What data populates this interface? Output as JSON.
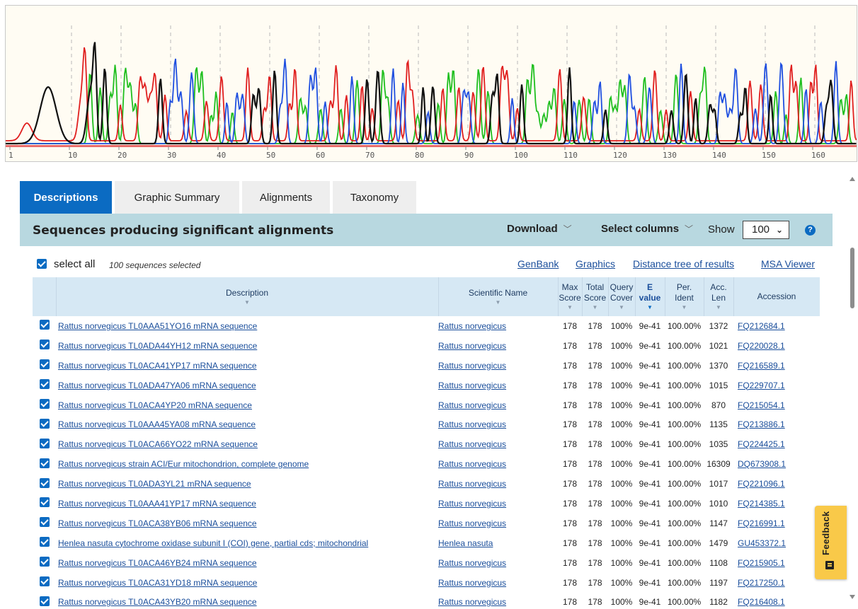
{
  "chromatogram": {
    "axis_ticks": [
      "1",
      "10",
      "20",
      "30",
      "40",
      "50",
      "60",
      "70",
      "80",
      "90",
      "100",
      "110",
      "120",
      "130",
      "140",
      "150",
      "160"
    ]
  },
  "tabs": [
    {
      "label": "Descriptions",
      "active": true
    },
    {
      "label": "Graphic Summary",
      "active": false
    },
    {
      "label": "Alignments",
      "active": false
    },
    {
      "label": "Taxonomy",
      "active": false
    }
  ],
  "header": {
    "title": "Sequences producing significant alignments",
    "download_label": "Download",
    "select_columns_label": "Select columns",
    "show_label": "Show",
    "show_value": "100",
    "help_glyph": "?"
  },
  "select_all": {
    "label": "select all",
    "count_text": "100 sequences selected",
    "links": [
      "GenBank",
      "Graphics",
      "Distance tree of results",
      "MSA Viewer"
    ]
  },
  "table": {
    "columns": [
      {
        "label": "",
        "sub": ""
      },
      {
        "label": "Description",
        "sub": ""
      },
      {
        "label": "Scientific Name",
        "sub": ""
      },
      {
        "label": "Max",
        "sub": "Score"
      },
      {
        "label": "Total",
        "sub": "Score"
      },
      {
        "label": "Query",
        "sub": "Cover"
      },
      {
        "label": "E",
        "sub": "value"
      },
      {
        "label": "Per.",
        "sub": "Ident"
      },
      {
        "label": "Acc.",
        "sub": "Len"
      },
      {
        "label": "Accession",
        "sub": ""
      }
    ],
    "sorted_column": "E value",
    "rows": [
      {
        "description": "Rattus norvegicus TL0AAA51YO16 mRNA sequence",
        "scientific_name": "Rattus norvegicus",
        "max_score": "178",
        "total_score": "178",
        "query_cover": "100%",
        "e_value": "9e-41",
        "per_ident": "100.00%",
        "acc_len": "1372",
        "accession": "FQ212684.1"
      },
      {
        "description": "Rattus norvegicus TL0ADA44YH12 mRNA sequence",
        "scientific_name": "Rattus norvegicus",
        "max_score": "178",
        "total_score": "178",
        "query_cover": "100%",
        "e_value": "9e-41",
        "per_ident": "100.00%",
        "acc_len": "1021",
        "accession": "FQ220028.1"
      },
      {
        "description": "Rattus norvegicus TL0ACA41YP17 mRNA sequence",
        "scientific_name": "Rattus norvegicus",
        "max_score": "178",
        "total_score": "178",
        "query_cover": "100%",
        "e_value": "9e-41",
        "per_ident": "100.00%",
        "acc_len": "1370",
        "accession": "FQ216589.1"
      },
      {
        "description": "Rattus norvegicus TL0ADA47YA06 mRNA sequence",
        "scientific_name": "Rattus norvegicus",
        "max_score": "178",
        "total_score": "178",
        "query_cover": "100%",
        "e_value": "9e-41",
        "per_ident": "100.00%",
        "acc_len": "1015",
        "accession": "FQ229707.1"
      },
      {
        "description": "Rattus norvegicus TL0ACA4YP20 mRNA sequence",
        "scientific_name": "Rattus norvegicus",
        "max_score": "178",
        "total_score": "178",
        "query_cover": "100%",
        "e_value": "9e-41",
        "per_ident": "100.00%",
        "acc_len": "870",
        "accession": "FQ215054.1"
      },
      {
        "description": "Rattus norvegicus TL0AAA45YA08 mRNA sequence",
        "scientific_name": "Rattus norvegicus",
        "max_score": "178",
        "total_score": "178",
        "query_cover": "100%",
        "e_value": "9e-41",
        "per_ident": "100.00%",
        "acc_len": "1135",
        "accession": "FQ213886.1"
      },
      {
        "description": "Rattus norvegicus TL0ACA66YO22 mRNA sequence",
        "scientific_name": "Rattus norvegicus",
        "max_score": "178",
        "total_score": "178",
        "query_cover": "100%",
        "e_value": "9e-41",
        "per_ident": "100.00%",
        "acc_len": "1035",
        "accession": "FQ224425.1"
      },
      {
        "description": "Rattus norvegicus strain ACI/Eur mitochondrion, complete genome",
        "scientific_name": "Rattus norvegicus",
        "max_score": "178",
        "total_score": "178",
        "query_cover": "100%",
        "e_value": "9e-41",
        "per_ident": "100.00%",
        "acc_len": "16309",
        "accession": "DQ673908.1"
      },
      {
        "description": "Rattus norvegicus TL0ADA3YL21 mRNA sequence",
        "scientific_name": "Rattus norvegicus",
        "max_score": "178",
        "total_score": "178",
        "query_cover": "100%",
        "e_value": "9e-41",
        "per_ident": "100.00%",
        "acc_len": "1017",
        "accession": "FQ221096.1"
      },
      {
        "description": "Rattus norvegicus TL0AAA41YP17 mRNA sequence",
        "scientific_name": "Rattus norvegicus",
        "max_score": "178",
        "total_score": "178",
        "query_cover": "100%",
        "e_value": "9e-41",
        "per_ident": "100.00%",
        "acc_len": "1010",
        "accession": "FQ214385.1"
      },
      {
        "description": "Rattus norvegicus TL0ACA38YB06 mRNA sequence",
        "scientific_name": "Rattus norvegicus",
        "max_score": "178",
        "total_score": "178",
        "query_cover": "100%",
        "e_value": "9e-41",
        "per_ident": "100.00%",
        "acc_len": "1147",
        "accession": "FQ216991.1"
      },
      {
        "description": "Henlea nasuta cytochrome oxidase subunit I (COI) gene, partial cds; mitochondrial",
        "scientific_name": "Henlea nasuta",
        "max_score": "178",
        "total_score": "178",
        "query_cover": "100%",
        "e_value": "9e-41",
        "per_ident": "100.00%",
        "acc_len": "1479",
        "accession": "GU453372.1"
      },
      {
        "description": "Rattus norvegicus TL0ACA46YB24 mRNA sequence",
        "scientific_name": "Rattus norvegicus",
        "max_score": "178",
        "total_score": "178",
        "query_cover": "100%",
        "e_value": "9e-41",
        "per_ident": "100.00%",
        "acc_len": "1108",
        "accession": "FQ215905.1"
      },
      {
        "description": "Rattus norvegicus TL0ACA31YD18 mRNA sequence",
        "scientific_name": "Rattus norvegicus",
        "max_score": "178",
        "total_score": "178",
        "query_cover": "100%",
        "e_value": "9e-41",
        "per_ident": "100.00%",
        "acc_len": "1197",
        "accession": "FQ217250.1"
      },
      {
        "description": "Rattus norvegicus TL0ACA43YB20 mRNA sequence",
        "scientific_name": "Rattus norvegicus",
        "max_score": "178",
        "total_score": "178",
        "query_cover": "100%",
        "e_value": "9e-41",
        "per_ident": "100.00%",
        "acc_len": "1182",
        "accession": "FQ216408.1"
      }
    ]
  },
  "feedback": {
    "label": "Feedback"
  },
  "colors": {
    "accent": "#0b6bc2",
    "header_band": "#b8d8e0",
    "link": "#1a4e9b",
    "feedback": "#f9c949"
  }
}
